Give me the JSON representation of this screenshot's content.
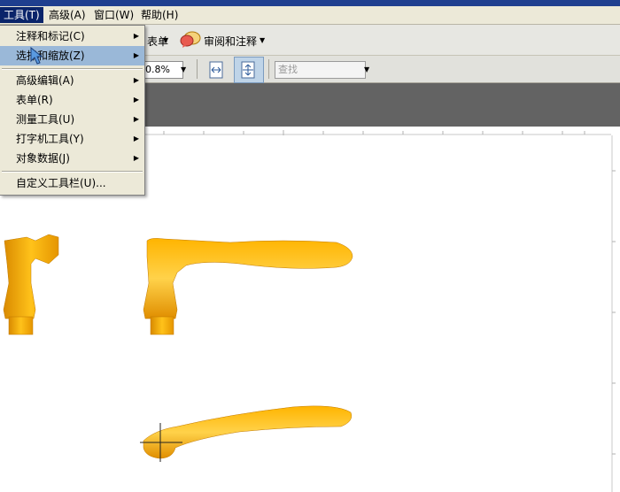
{
  "menubar": {
    "items": [
      "工具(T)",
      "高级(A)",
      "窗口(W)",
      "帮助(H)"
    ]
  },
  "toolbar1": {
    "form_label": "表单",
    "review_label": "审阅和注释"
  },
  "toolbar2": {
    "zoom_value": "0.8%",
    "search_placeholder": "查找"
  },
  "dropdown": {
    "items": [
      {
        "label": "注释和标记(C)",
        "submenu": true
      },
      {
        "label": "选择和缩放(Z)",
        "submenu": true,
        "highlighted": true
      },
      {
        "label": "高级编辑(A)",
        "submenu": true
      },
      {
        "label": "表单(R)",
        "submenu": true
      },
      {
        "label": "测量工具(U)",
        "submenu": true
      },
      {
        "label": "打字机工具(Y)",
        "submenu": true
      },
      {
        "label": "对象数据(J)",
        "submenu": true
      },
      {
        "label": "自定义工具栏(U)...",
        "submenu": false
      }
    ]
  },
  "colors": {
    "menu_bg": "#ece9d8",
    "menu_active": "#0a246a",
    "highlight": "#9ab8d8",
    "doc_gray": "#636363",
    "part_orange": "#f5a800"
  }
}
